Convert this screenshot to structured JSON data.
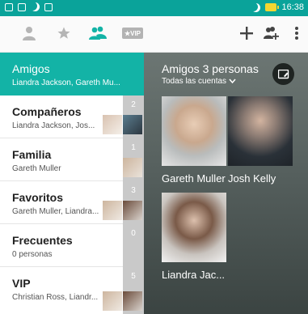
{
  "status": {
    "time": "16:38"
  },
  "toolbar": {
    "vip_label": "★VIP",
    "icons": [
      "person-icon",
      "star-icon",
      "group-icon",
      "vip-icon",
      "add-icon",
      "add-group-icon",
      "more-icon"
    ]
  },
  "sidebar": {
    "items": [
      {
        "title": "Amigos",
        "subtitle": "Liandra Jackson, Gareth Mu...",
        "count": ""
      },
      {
        "title": "Compañeros",
        "subtitle": "Liandra Jackson, Jos...",
        "count": "2"
      },
      {
        "title": "Familia",
        "subtitle": "Gareth Muller",
        "count": "1"
      },
      {
        "title": "Favoritos",
        "subtitle": "Gareth Muller, Liandra...",
        "count": "3"
      },
      {
        "title": "Frecuentes",
        "subtitle": "0 personas",
        "count": "0"
      },
      {
        "title": "VIP",
        "subtitle": "Christian Ross, Liandr...",
        "count": "5"
      }
    ]
  },
  "panel": {
    "title": "Amigos 3 personas",
    "subtitle": "Todas las cuentas",
    "contacts": [
      {
        "name": "Gareth Muller"
      },
      {
        "name": "Josh Kelly"
      },
      {
        "name": "Liandra Jac..."
      }
    ]
  },
  "colors": {
    "accent": "#13b3a6",
    "statusbar": "#0aa39a",
    "count_bg": "#c9c9c9"
  }
}
